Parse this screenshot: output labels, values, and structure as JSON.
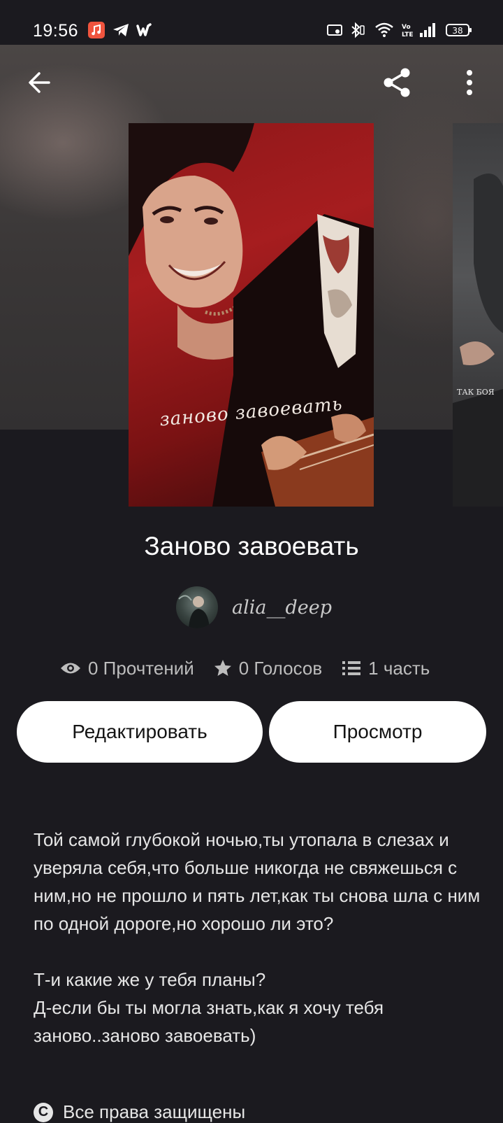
{
  "status_bar": {
    "time": "19:56",
    "battery": "38",
    "notification_icons": [
      "music-app-icon",
      "telegram-icon",
      "wattpad-icon"
    ],
    "system_icons": [
      "cast-icon",
      "bluetooth-icon",
      "wifi-icon",
      "volte-icon",
      "signal-icon",
      "battery-icon"
    ]
  },
  "toolbar": {
    "back_icon": "arrow-left-icon",
    "share_icon": "share-icon",
    "more_icon": "more-vert-icon"
  },
  "cover": {
    "script_text": "заново завоевать",
    "side_cover_text": "ТАК БОЯ"
  },
  "book": {
    "title": "Заново завоевать",
    "author": "alia__deep"
  },
  "stats": {
    "reads": "0 Прочтений",
    "votes": "0 Голосов",
    "parts": "1 часть"
  },
  "buttons": {
    "edit": "Редактировать",
    "preview": "Просмотр"
  },
  "description": {
    "paragraph1": "Той самой глубокой ночью,ты утопала в слезах и уверяла себя,что больше никогда не свяжешься с ним,но не прошло и пять лет,как ты снова шла с ним по одной дороге,но хорошо ли это?",
    "line1": "Т-и какие же у тебя планы?",
    "line2": "Д-если бы ты могла знать,как я хочу тебя заново..заново завоевать)"
  },
  "rights": "Все права защищены",
  "colors": {
    "background": "#1b1a1f",
    "button_bg": "#ffffff",
    "text_secondary": "#bdbdbd"
  }
}
